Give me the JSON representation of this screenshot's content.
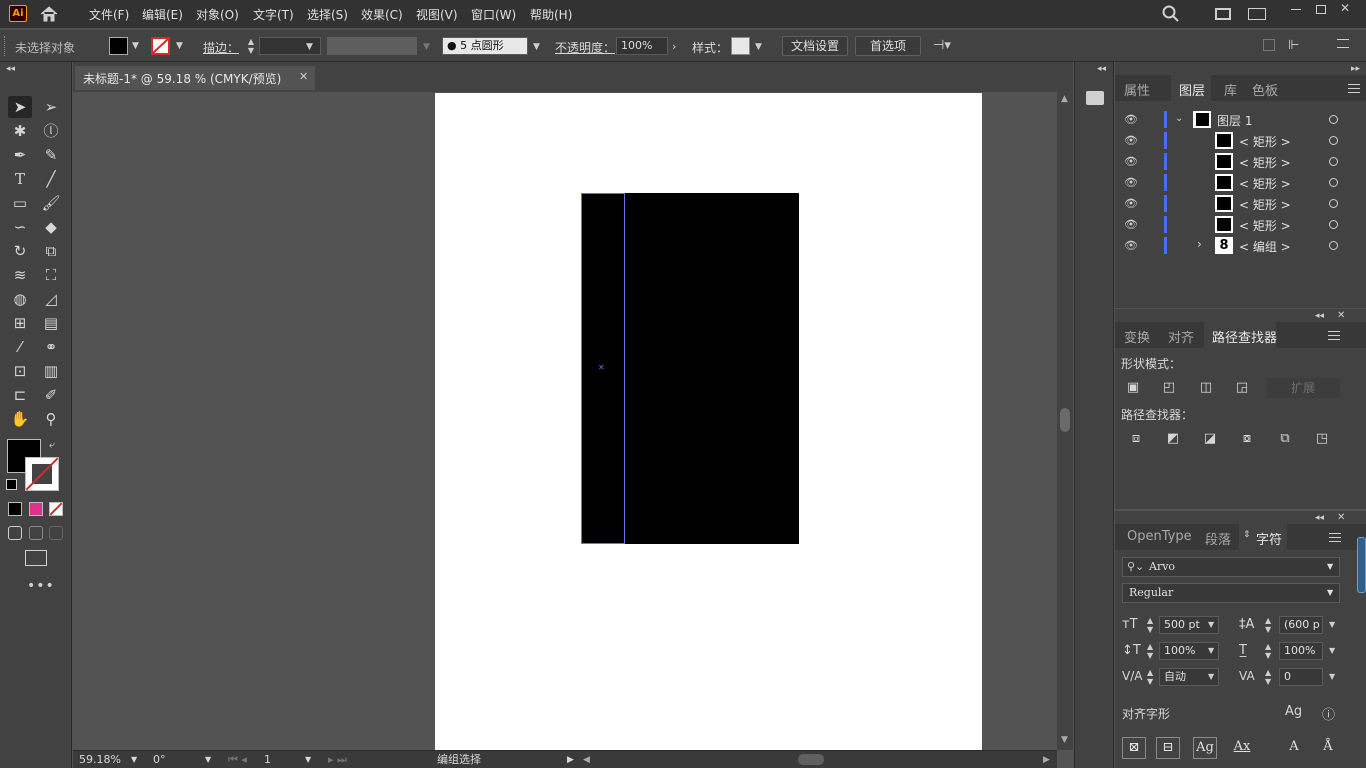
{
  "app": {
    "logo": "Ai"
  },
  "menu": [
    "文件(F)",
    "编辑(E)",
    "对象(O)",
    "文字(T)",
    "选择(S)",
    "效果(C)",
    "视图(V)",
    "窗口(W)",
    "帮助(H)"
  ],
  "control_bar": {
    "selection_status": "未选择对象",
    "stroke_label": "描边：",
    "brush_label": "5 点圆形",
    "opacity_label": "不透明度：",
    "opacity_value": "100%",
    "style_label": "样式：",
    "doc_settings": "文档设置",
    "preferences": "首选项"
  },
  "document": {
    "tab_title": "未标题-1* @ 59.18 % (CMYK/预览)"
  },
  "status_bar": {
    "zoom": "59.18%",
    "rotation": "0°",
    "artboard": "1",
    "tool": "编组选择"
  },
  "panels": {
    "layers": {
      "tabs": [
        "属性",
        "图层",
        "库",
        "色板"
      ],
      "active_tab": "图层",
      "items": [
        {
          "name": "图层 1",
          "kind": "layer"
        },
        {
          "name": "< 矩形 >",
          "kind": "rect"
        },
        {
          "name": "< 矩形 >",
          "kind": "rect"
        },
        {
          "name": "< 矩形 >",
          "kind": "rect"
        },
        {
          "name": "< 矩形 >",
          "kind": "rect"
        },
        {
          "name": "< 矩形 >",
          "kind": "rect"
        },
        {
          "name": "< 编组 >",
          "kind": "group"
        }
      ]
    },
    "pathfinder": {
      "tabs": [
        "变换",
        "对齐",
        "路径查找器"
      ],
      "active_tab": "路径查找器",
      "shape_modes_label": "形状模式：",
      "expand_label": "扩展",
      "pathfinders_label": "路径查找器："
    },
    "character": {
      "tabs": [
        "OpenType",
        "段落",
        "字符"
      ],
      "active_tab": "字符",
      "font_family": "Arvo",
      "font_style": "Regular",
      "font_size": "500 pt",
      "leading": "(600 p",
      "vertical_scale": "100%",
      "horizontal_scale": "100%",
      "kerning": "自动",
      "tracking": "0",
      "align_glyphs_label": "对齐字形"
    }
  }
}
